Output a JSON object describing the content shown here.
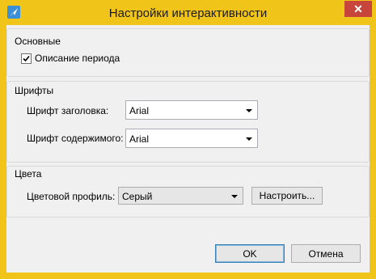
{
  "window": {
    "title": "Настройки интерактивности",
    "close_glyph": "✕",
    "icon": "app-feather-icon",
    "accent": "#f0c419",
    "close_color": "#c7453a"
  },
  "groups": {
    "basic": {
      "title": "Основные",
      "checkbox": {
        "label": "Описание периода",
        "checked": true
      }
    },
    "fonts": {
      "title": "Шрифты",
      "header_font_label": "Шрифт заголовка:",
      "header_font_value": "Arial",
      "content_font_label": "Шрифт содержимого:",
      "content_font_value": "Arial"
    },
    "colors": {
      "title": "Цвета",
      "profile_label": "Цветовой профиль:",
      "profile_value": "Серый",
      "configure_label": "Настроить..."
    }
  },
  "footer": {
    "ok_label": "OK",
    "cancel_label": "Отмена"
  }
}
